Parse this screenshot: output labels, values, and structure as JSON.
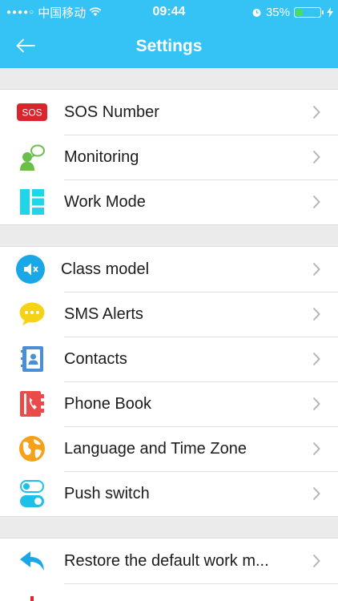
{
  "status_bar": {
    "carrier": "中国移动",
    "time": "09:44",
    "battery": "35%",
    "battery_level": 0.35
  },
  "header": {
    "title": "Settings"
  },
  "groups": [
    {
      "items": [
        {
          "label": "SOS Number",
          "icon": "sos-icon",
          "icon_text": "SOS"
        },
        {
          "label": "Monitoring",
          "icon": "monitoring-icon"
        },
        {
          "label": "Work Mode",
          "icon": "work-mode-icon"
        }
      ]
    },
    {
      "items": [
        {
          "label": "Class model",
          "icon": "mute-icon"
        },
        {
          "label": "SMS Alerts",
          "icon": "chat-bubble-icon"
        },
        {
          "label": "Contacts",
          "icon": "contacts-book-icon"
        },
        {
          "label": "Phone Book",
          "icon": "phone-book-icon"
        },
        {
          "label": "Language and Time Zone",
          "icon": "globe-icon"
        },
        {
          "label": "Push switch",
          "icon": "toggle-switch-icon"
        }
      ]
    },
    {
      "items": [
        {
          "label": "Restore the default work m...",
          "icon": "restore-arrow-icon"
        }
      ]
    }
  ],
  "colors": {
    "header": "#35c2f4",
    "sos_red": "#d8262c",
    "green": "#6abf4b",
    "cyan": "#1fd6e8",
    "blue": "#1aa7e8",
    "yellow": "#f6d214",
    "orange": "#f5a21a"
  }
}
